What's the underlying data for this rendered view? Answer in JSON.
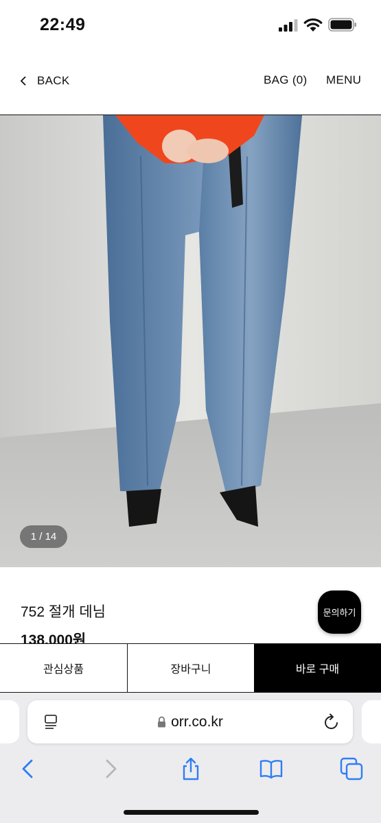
{
  "status_bar": {
    "time": "22:49"
  },
  "header": {
    "back_label": "BACK",
    "bag_label": "BAG (0)",
    "menu_label": "MENU"
  },
  "gallery": {
    "counter": "1 / 14"
  },
  "product": {
    "name": "752 절개 데님",
    "price": "138,000원"
  },
  "inquiry_label": "문의하기",
  "actions": {
    "wishlist": "관심상품",
    "cart": "장바구니",
    "buy_now": "바로 구매"
  },
  "browser": {
    "url": "orr.co.kr"
  },
  "colors": {
    "accent": "#000000",
    "denim": "#5a80a8",
    "sweater": "#f0461e",
    "safari_icon": "#2f7cf6"
  }
}
